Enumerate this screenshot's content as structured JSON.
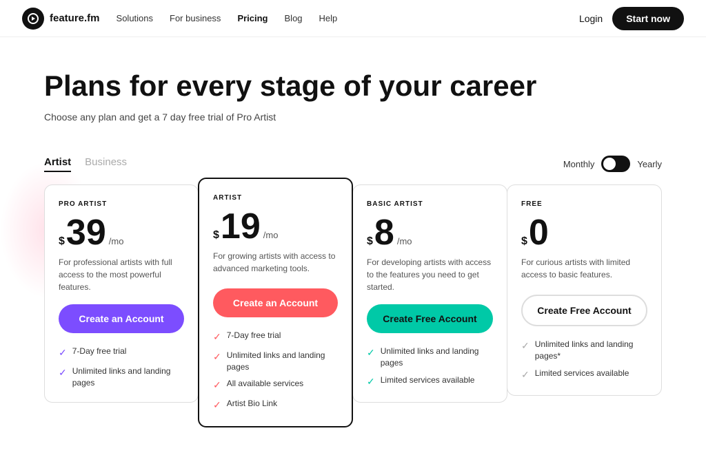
{
  "nav": {
    "logo_text": "feature.fm",
    "logo_icon": "f",
    "links": [
      {
        "label": "Solutions",
        "active": false
      },
      {
        "label": "For business",
        "active": false
      },
      {
        "label": "Pricing",
        "active": true
      },
      {
        "label": "Blog",
        "active": false
      },
      {
        "label": "Help",
        "active": false
      }
    ],
    "login_label": "Login",
    "start_label": "Start now"
  },
  "hero": {
    "title": "Plans for every stage of your career",
    "subtitle": "Choose any plan and get a 7 day free trial of Pro Artist"
  },
  "tabs": [
    {
      "label": "Artist",
      "active": true
    },
    {
      "label": "Business",
      "active": false
    }
  ],
  "billing": {
    "monthly_label": "Monthly",
    "yearly_label": "Yearly"
  },
  "plans": [
    {
      "id": "pro-artist",
      "label": "PRO ARTIST",
      "price_dollar": "$",
      "price_amount": "39",
      "price_period": "/mo",
      "description": "For professional artists with full access to the most powerful features.",
      "btn_label": "Create an Account",
      "btn_style": "purple",
      "featured": false,
      "features": [
        "7-Day free trial",
        "Unlimited links and landing pages"
      ]
    },
    {
      "id": "artist",
      "label": "ARTIST",
      "price_dollar": "$",
      "price_amount": "19",
      "price_period": "/mo",
      "description": "For growing artists with access to advanced marketing tools.",
      "btn_label": "Create an Account",
      "btn_style": "coral",
      "featured": true,
      "features": [
        "7-Day free trial",
        "Unlimited links and landing pages",
        "All available services",
        "Artist Bio Link"
      ]
    },
    {
      "id": "basic-artist",
      "label": "BASIC ARTIST",
      "price_dollar": "$",
      "price_amount": "8",
      "price_period": "/mo",
      "description": "For developing artists with access to the features you need to get started.",
      "btn_label": "Create Free Account",
      "btn_style": "teal",
      "featured": false,
      "features": [
        "Unlimited links and landing pages",
        "Limited services available"
      ]
    },
    {
      "id": "free",
      "label": "FREE",
      "price_dollar": "$",
      "price_amount": "0",
      "price_period": "",
      "description": "For curious artists with limited access to basic features.",
      "btn_label": "Create Free Account",
      "btn_style": "outline",
      "featured": false,
      "features": [
        "Unlimited links and landing pages*",
        "Limited services available"
      ]
    }
  ]
}
